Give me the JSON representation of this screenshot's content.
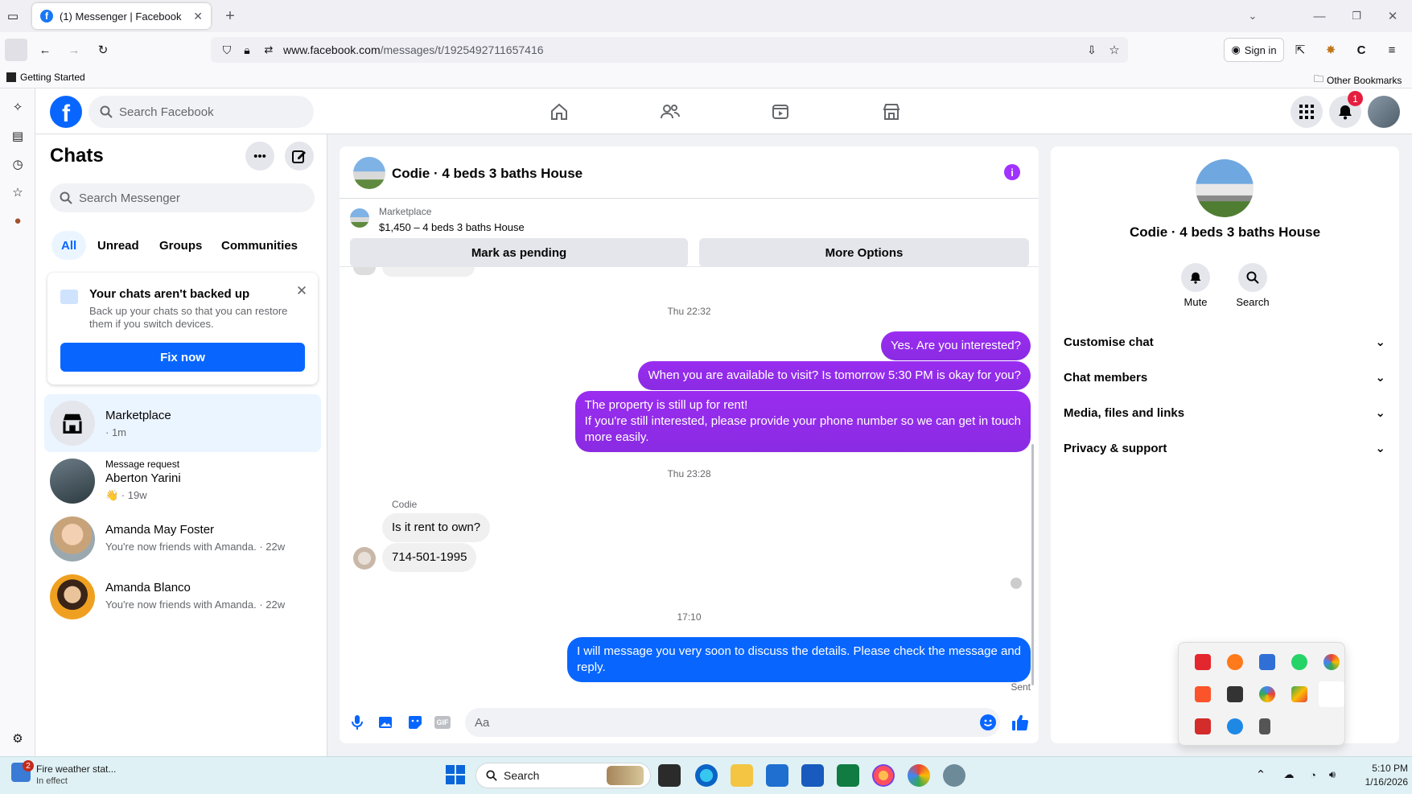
{
  "browser": {
    "tab_title": "(1) Messenger | Facebook",
    "url_host": "www.facebook.com",
    "url_path": "/messages/t/1925492711657416",
    "sign_in": "Sign in",
    "bookmark_getting_started": "Getting Started",
    "bookmark_other": "Other Bookmarks"
  },
  "fb": {
    "search_placeholder": "Search Facebook",
    "notification_count": "1"
  },
  "chats": {
    "title": "Chats",
    "search_placeholder": "Search Messenger",
    "filters": [
      "All",
      "Unread",
      "Groups",
      "Communities"
    ],
    "backup": {
      "title": "Your chats aren't backed up",
      "body_line1": "Back up your chats so that you can restore",
      "body_line2": "them if you switch devices.",
      "button": "Fix now"
    },
    "list": [
      {
        "name": "Marketplace",
        "sub": "· 1m",
        "request": ""
      },
      {
        "name": "Aberton Yarini",
        "sub": "👋 · 19w",
        "request": "Message request"
      },
      {
        "name": "Amanda May Foster",
        "sub": "You're now friends with Amanda. · 22w",
        "request": ""
      },
      {
        "name": "Amanda Blanco",
        "sub": "You're now friends with Amanda. · 22w",
        "request": ""
      }
    ]
  },
  "conversation": {
    "title": "Codie · 4 beds 3 baths House",
    "marketplace_label": "Marketplace",
    "listing": "$1,450 – 4 beds 3 baths House",
    "mark_pending": "Mark as pending",
    "more_options": "More Options",
    "ts1": "Thu 22:32",
    "msg_out1": "Yes. Are you interested?",
    "msg_out2": "When you are available to visit? Is tomorrow 5:30 PM is okay for you?",
    "msg_out3_l1": "The property is still up for rent!",
    "msg_out3_l2": "If you're still interested, please provide your phone number so we can get in touch",
    "msg_out3_l3": "more easily.",
    "ts2": "Thu 23:28",
    "sender": "Codie",
    "msg_in1": "Is it rent to own?",
    "msg_in2": "714-501-1995",
    "ts3": "17:10",
    "msg_out4_l1": "I will message you very soon to discuss the details. Please check the message and",
    "msg_out4_l2": "reply.",
    "sent_status": "Sent",
    "composer_placeholder": "Aa"
  },
  "info": {
    "name": "Codie · 4 beds 3 baths House",
    "mute": "Mute",
    "search": "Search",
    "sections": [
      "Customise chat",
      "Chat members",
      "Media, files and links",
      "Privacy & support"
    ]
  },
  "taskbar": {
    "weather_badge": "2",
    "weather_title": "Fire weather stat...",
    "weather_sub": "In effect",
    "search": "Search",
    "time": "5:10 PM",
    "date": "1/16/2026"
  },
  "colors": {
    "fb_blue": "#0866ff",
    "bubble_purple": "#8a2be2",
    "badge_red": "#e41e3f"
  }
}
